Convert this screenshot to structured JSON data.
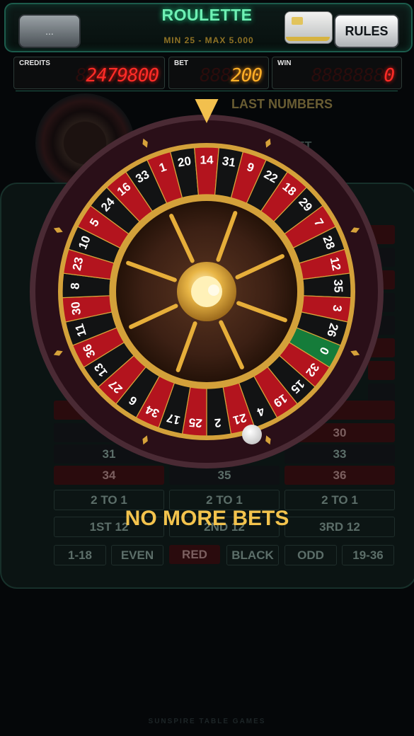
{
  "header": {
    "menu_label": "...",
    "title": "ROULETTE",
    "limits": "MIN 25  -  MAX 5.000",
    "rules_label": "RULES"
  },
  "meters": {
    "credits": {
      "label": "CREDITS",
      "ghost": "88888888",
      "value": "2479800"
    },
    "bet": {
      "label": "BET",
      "ghost": "888888",
      "value": "200"
    },
    "win": {
      "label": "WIN",
      "ghost": "88888888",
      "value": "0"
    }
  },
  "background": {
    "last_numbers": "LAST NUMBERS",
    "bet_partial": "ET",
    "rows": [
      [
        "",
        "",
        "30"
      ],
      [
        "31",
        "",
        "33"
      ],
      [
        "34",
        "35",
        "36"
      ]
    ],
    "columns": [
      "2 TO 1",
      "2 TO 1",
      "2 TO 1"
    ],
    "dozens": [
      "1ST 12",
      "2ND 12",
      "3RD 12"
    ],
    "outside": [
      "1-18",
      "EVEN",
      "RED",
      "BLACK",
      "ODD",
      "19-36"
    ]
  },
  "wheel": {
    "numbers": [
      "0",
      "32",
      "15",
      "19",
      "4",
      "21",
      "2",
      "25",
      "17",
      "34",
      "6",
      "27",
      "13",
      "36",
      "11",
      "30",
      "8",
      "23",
      "10",
      "5",
      "24",
      "16",
      "33",
      "1",
      "20",
      "14",
      "31",
      "9",
      "22",
      "18",
      "29",
      "7",
      "28",
      "12",
      "35",
      "3",
      "26"
    ],
    "colors": {
      "red": "#b3141e",
      "black": "#121314",
      "green": "#157c3a",
      "gold": "#d8a53a",
      "rim": "#3a1620"
    }
  },
  "status_message": "NO MORE BETS",
  "footer": "SUNSPIRE TABLE GAMES"
}
